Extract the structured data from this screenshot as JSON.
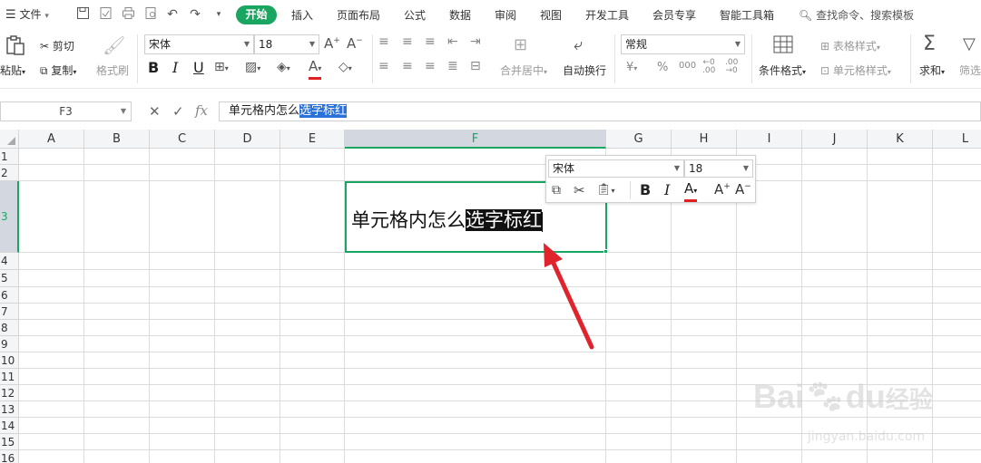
{
  "menubar": {
    "file": "文件",
    "tabs": [
      "开始",
      "插入",
      "页面布局",
      "公式",
      "数据",
      "审阅",
      "视图",
      "开发工具",
      "会员专享",
      "智能工具箱"
    ],
    "search": "查找命令、搜索模板"
  },
  "ribbon": {
    "paste": "粘贴",
    "cut": "剪切",
    "copy": "复制",
    "format_painter": "格式刷",
    "font_name": "宋体",
    "font_size": "18",
    "merge_center": "合并居中",
    "wrap_text": "自动换行",
    "number_format": "常规",
    "cond_format": "条件格式",
    "table_style": "表格样式",
    "cell_style": "单元格样式",
    "sum": "求和",
    "filter": "筛选"
  },
  "formula_bar": {
    "cell_ref": "F3",
    "fx": "fx",
    "text_plain": "单元格内怎么",
    "text_selected": "选字标红"
  },
  "grid": {
    "columns": [
      "A",
      "B",
      "C",
      "D",
      "E",
      "F",
      "G",
      "H",
      "I",
      "J",
      "K",
      "L"
    ],
    "rows": [
      "1",
      "2",
      "3",
      "4",
      "5",
      "6",
      "7",
      "8",
      "9",
      "10",
      "11",
      "12",
      "13",
      "14",
      "15",
      "16"
    ],
    "active_column": "F",
    "active_row": "3",
    "cell_text_plain": "单元格内怎么",
    "cell_text_selected": "选字标红"
  },
  "minibar": {
    "font_name": "宋体",
    "font_size": "18"
  },
  "colors": {
    "accent": "#1aa660",
    "selection_blue": "#2b72d8",
    "arrow_red": "#e0242e"
  },
  "watermark": {
    "brand": "Bai",
    "brand_suffix": "经验",
    "url": "jingyan.baidu.com"
  }
}
